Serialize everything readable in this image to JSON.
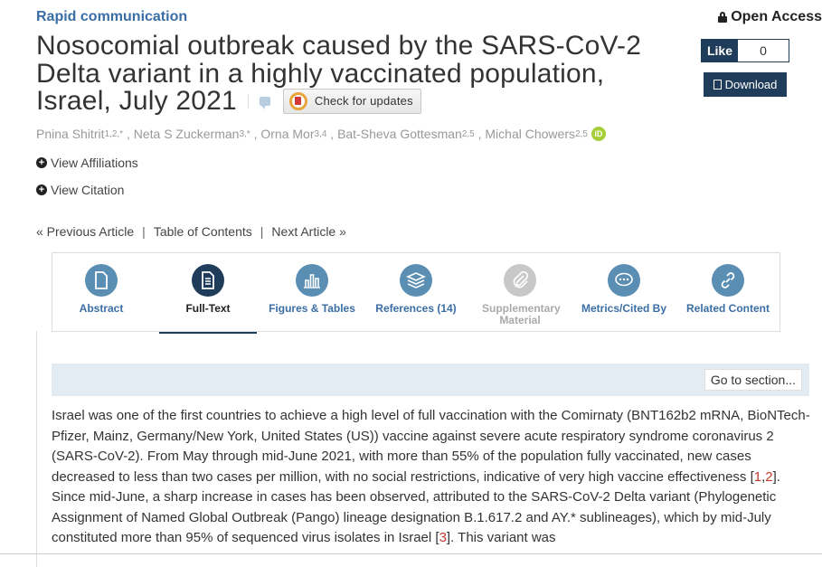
{
  "article": {
    "category": "Rapid communication",
    "access": "Open Access",
    "title_lines": [
      "Nosocomial outbreak caused by the SARS-CoV-2",
      "Delta variant in a highly vaccinated population,",
      "Israel, July 2021"
    ],
    "check_updates": "Check for updates",
    "like_label": "Like",
    "like_count": "0",
    "download_label": "Download",
    "authors": [
      {
        "name": "Pnina Shitrit",
        "sup": "1,2,*"
      },
      {
        "name": "Neta S Zuckerman",
        "sup": "3,*"
      },
      {
        "name": "Orna Mor",
        "sup": "3,4"
      },
      {
        "name": "Bat-Sheva Gottesman",
        "sup": "2,5"
      },
      {
        "name": "Michal Chowers",
        "sup": "2,5"
      }
    ],
    "orcid_label": "iD",
    "view_affiliations": "View Affiliations",
    "view_citation": "View Citation"
  },
  "nav": {
    "prev": "« Previous Article",
    "toc": "Table of Contents",
    "next": "Next Article »",
    "sep": "|"
  },
  "tabs": [
    {
      "label": "Abstract",
      "icon": "document-icon",
      "state": "normal"
    },
    {
      "label": "Full-Text",
      "icon": "full-text-icon",
      "state": "active"
    },
    {
      "label": "Figures & Tables",
      "icon": "bar-chart-icon",
      "state": "normal"
    },
    {
      "label": "References (14)",
      "icon": "books-icon",
      "state": "normal"
    },
    {
      "label": "Supplementary Material",
      "icon": "paperclip-icon",
      "state": "disabled"
    },
    {
      "label": "Metrics/Cited By",
      "icon": "speech-bubble-icon",
      "state": "normal"
    },
    {
      "label": "Related Content",
      "icon": "link-icon",
      "state": "normal"
    }
  ],
  "goto_section": "Go to section...",
  "body": {
    "p1": "Israel was one of the first countries to achieve a high level of full vaccination with the Comirnaty (BNT162b2 mRNA, BioNTech-Pfizer, Mainz, Germany/New York, United States (US)) vaccine against severe acute respiratory syndrome coronavirus 2 (SARS-CoV-2). From May through mid-June 2021, with more than 55% of the population fully vaccinated, new cases decreased to less than two cases per million, with no social restrictions, indicative of very high vaccine effectiveness [",
    "ref1": "1",
    "comma": ",",
    "ref2": "2",
    "p2": "]. Since mid-June, a sharp increase in cases has been observed, attributed to the SARS-CoV-2 Delta variant (Phylogenetic Assignment of Named Global Outbreak (Pango) lineage designation B.1.617.2 and AY.* sublineages), which by mid-July constituted more than 95% of sequenced virus isolates in Israel [",
    "ref3": "3",
    "p3": "]. This variant was"
  }
}
